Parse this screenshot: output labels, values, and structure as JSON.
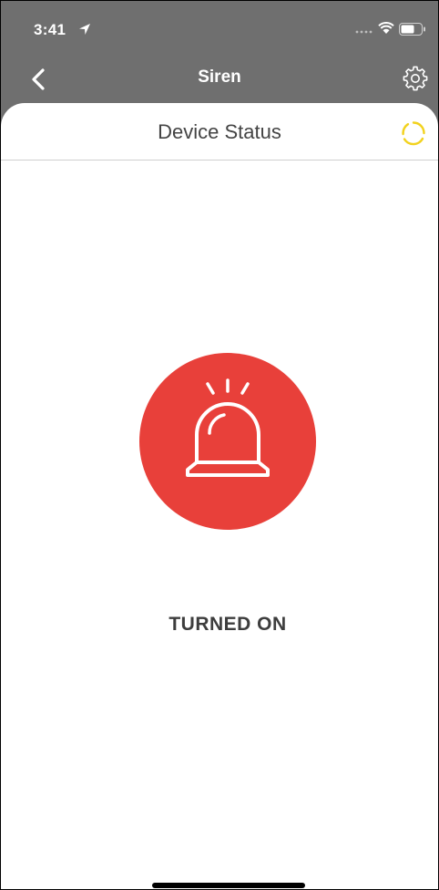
{
  "status_bar": {
    "time": "3:41",
    "icons": [
      "location-arrow-icon",
      "signal-dots-icon",
      "wifi-icon",
      "battery-icon"
    ]
  },
  "nav": {
    "title": "Siren",
    "back_icon": "chevron-left-icon",
    "settings_icon": "gear-icon"
  },
  "header": {
    "title": "Device Status",
    "refresh_icon": "refresh-spinner-icon",
    "refresh_color": "#f2d21e"
  },
  "device": {
    "icon": "siren-icon",
    "status": "TURNED ON",
    "accent_color": "#e8403a"
  },
  "colors": {
    "nav_background": "#6f6f6f",
    "sheet_background": "#ffffff",
    "text_dark": "#3d3d3d"
  }
}
